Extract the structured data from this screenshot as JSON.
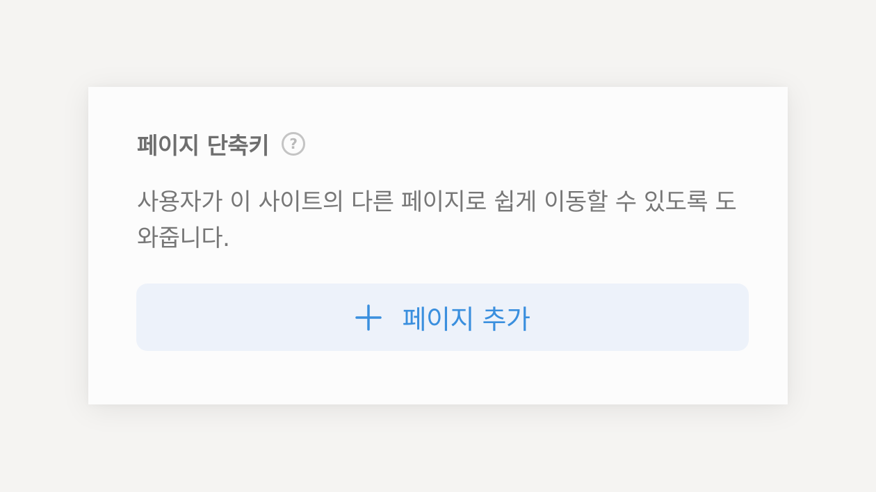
{
  "panel": {
    "title": "페이지 단축키",
    "help_icon": "question-circle-icon",
    "help_glyph": "?",
    "description": "사용자가 이 사이트의 다른 페이지로 쉽게 이동할 수 있도록 도와줍니다.",
    "add_button": {
      "icon": "plus-icon",
      "label": "페이지 추가"
    }
  },
  "colors": {
    "background": "#f5f4f2",
    "panel": "#fcfcfc",
    "title": "#6e6e6e",
    "text": "#777777",
    "button_bg": "#edf2fa",
    "accent": "#3a8fde"
  }
}
